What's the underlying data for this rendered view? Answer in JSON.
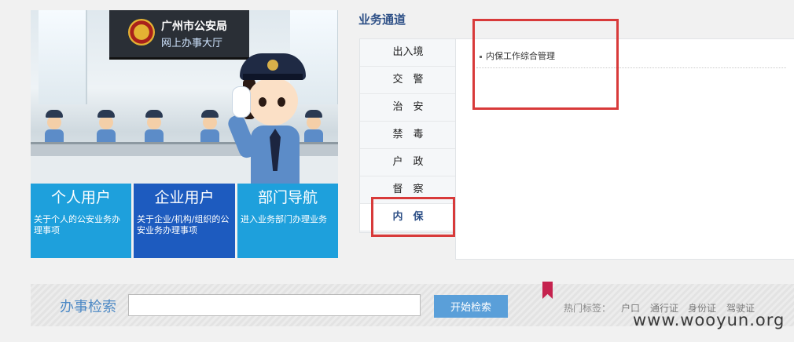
{
  "hero": {
    "sign_line1": "广州市公安局",
    "sign_line2": "网上办事大厅"
  },
  "tiles": [
    {
      "title": "个人用户",
      "desc": "关于个人的公安业务办理事项"
    },
    {
      "title": "企业用户",
      "desc": "关于企业/机构/组织的公安业务办理事项"
    },
    {
      "title": "部门导航",
      "desc": "进入业务部门办理业务"
    }
  ],
  "business": {
    "title": "业务通道",
    "tabs": [
      "出入境",
      "交　警",
      "治　安",
      "禁　毒",
      "户　政",
      "督　察",
      "内　保"
    ],
    "selected_tab": "内　保",
    "items": [
      "内保工作综合管理"
    ]
  },
  "search": {
    "label": "办事检索",
    "value": "",
    "button": "开始检索",
    "hot_label": "热门标签：",
    "hot_tags": [
      "户口",
      "通行证",
      "身份证",
      "驾驶证"
    ]
  },
  "watermark": "www.wooyun.org",
  "colors": {
    "accent": "#1ea0dc",
    "highlight": "#d83a3a",
    "nav_text": "#2d4f86"
  }
}
